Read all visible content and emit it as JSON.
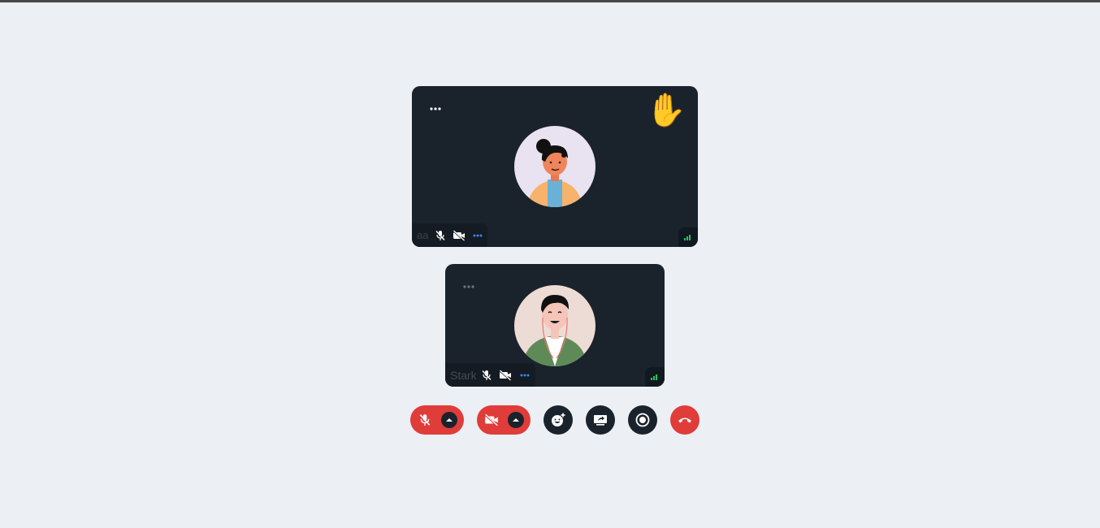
{
  "participants": [
    {
      "name": "aa",
      "raised_hand": "✋",
      "icons": [
        "more-horizontal-icon",
        "mic-off-icon",
        "video-off-icon",
        "more-options-icon",
        "signal-strength-icon"
      ]
    },
    {
      "name": "Stark",
      "icons": [
        "more-horizontal-icon",
        "mic-off-icon",
        "video-off-icon",
        "more-options-icon",
        "signal-strength-icon"
      ]
    }
  ],
  "controls": [
    {
      "id": "mic",
      "icon": "mic-off-icon",
      "state": "off"
    },
    {
      "id": "camera",
      "icon": "video-off-icon",
      "state": "off"
    },
    {
      "id": "reactions",
      "icon": "emoji-add-icon"
    },
    {
      "id": "screen-share",
      "icon": "screen-share-icon"
    },
    {
      "id": "record",
      "icon": "record-icon"
    },
    {
      "id": "leave",
      "icon": "phone-hangup-icon"
    }
  ],
  "colors": {
    "background": "#ECEFF4",
    "tile": "#1A232C",
    "danger": "#E03C3A",
    "accent_blue": "#3B82F6",
    "signal_green": "#22C55E"
  }
}
